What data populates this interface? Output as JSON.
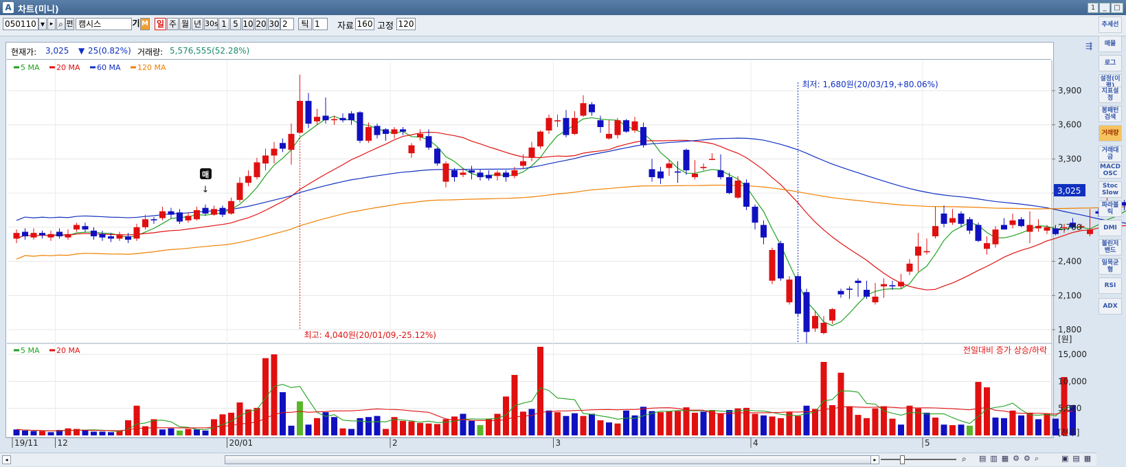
{
  "window": {
    "title": "차트(미니)",
    "logo_letter": "A",
    "buttons": [
      "1",
      "_",
      "□",
      "×"
    ]
  },
  "toolbar": {
    "code_value": "050110",
    "stock_name": "캠시스",
    "badge_gi": "기",
    "badge_m": "M",
    "periods": [
      "일",
      "주",
      "월",
      "년",
      "30s",
      "1",
      "5",
      "10",
      "20",
      "30"
    ],
    "period_input": "2",
    "tick_label": "틱",
    "tick_value": "1",
    "data_label": "자료",
    "data_value": "160",
    "fixed_label": "고정",
    "fixed_value": "120",
    "search_icon": "magnifier-icon",
    "pyeon_label": "편"
  },
  "infobar": {
    "price_label": "현재가:",
    "price_value": "3,025",
    "change_value": "25(0.82%)",
    "volume_label": "거래량:",
    "volume_value": "5,576,555(52.28%)"
  },
  "price_legend": [
    {
      "label": "5 MA",
      "color": "#1fa01f"
    },
    {
      "label": "20 MA",
      "color": "#e01010"
    },
    {
      "label": "60 MA",
      "color": "#1030c0"
    },
    {
      "label": "120 MA",
      "color": "#f08000"
    }
  ],
  "volume_legend": [
    {
      "label": "5 MA",
      "color": "#1fa01f"
    },
    {
      "label": "20 MA",
      "color": "#e01010"
    }
  ],
  "volume_note": "전일대비 증가 상승/하락",
  "annotations": {
    "high": "최고: 4,040원(20/01/09,-25.12%)",
    "low": "최저: 1,680원(20/03/19,+80.06%)",
    "buy_marker": "매"
  },
  "price_axis": {
    "ticks": [
      "3,900",
      "3,600",
      "3,300",
      "3,000",
      "2,700",
      "2,400",
      "2,100",
      "1,800"
    ],
    "unit": "[원]",
    "current": "3,025"
  },
  "volume_axis": {
    "ticks": [
      "15,000",
      "10,000",
      "5,000"
    ],
    "unit": "[천주]"
  },
  "date_axis": [
    "19/11",
    "12",
    "20/01",
    "2",
    "3",
    "4",
    "5"
  ],
  "right_tools": [
    "추세선",
    "매물",
    "로그",
    "설정(이평)",
    "지표설정",
    "봉패턴검색",
    "거래량",
    "거래대금",
    "MACD OSC",
    "Stoc Slow",
    "파라볼릭",
    "DMI",
    "볼린저밴드",
    "일목균형",
    "RSI",
    "ADX"
  ],
  "colors": {
    "up": "#e01010",
    "down": "#1010c0",
    "vol_up": "#e01010",
    "vol_down": "#1010c0",
    "vol_flat": "#5ab52a"
  },
  "chart_data": {
    "type": "candlestick",
    "price_range": [
      1680,
      4040
    ],
    "high_point": {
      "value": 4040,
      "date": "20/01/09"
    },
    "low_point": {
      "value": 1680,
      "date": "20/03/19"
    },
    "candles": [
      [
        2650,
        2600,
        2680,
        2560,
        1
      ],
      [
        2620,
        2660,
        2690,
        2590,
        0
      ],
      [
        2650,
        2610,
        2690,
        2590,
        1
      ],
      [
        2630,
        2650,
        2670,
        2600,
        0
      ],
      [
        2640,
        2610,
        2670,
        2580,
        1
      ],
      [
        2620,
        2660,
        2690,
        2600,
        0
      ],
      [
        2640,
        2610,
        2680,
        2590,
        1
      ],
      [
        2680,
        2720,
        2740,
        2660,
        1
      ],
      [
        2710,
        2680,
        2740,
        2660,
        0
      ],
      [
        2670,
        2620,
        2700,
        2590,
        0
      ],
      [
        2640,
        2610,
        2670,
        2580,
        0
      ],
      [
        2620,
        2600,
        2650,
        2570,
        0
      ],
      [
        2600,
        2630,
        2660,
        2580,
        1
      ],
      [
        2620,
        2590,
        2650,
        2560,
        0
      ],
      [
        2600,
        2700,
        2730,
        2580,
        1
      ],
      [
        2700,
        2770,
        2810,
        2680,
        1
      ],
      [
        2770,
        2760,
        2790,
        2730,
        0
      ],
      [
        2780,
        2840,
        2880,
        2760,
        1
      ],
      [
        2840,
        2810,
        2870,
        2780,
        0
      ],
      [
        2830,
        2750,
        2860,
        2730,
        0
      ],
      [
        2760,
        2800,
        2830,
        2740,
        1
      ],
      [
        2770,
        2850,
        2880,
        2760,
        1
      ],
      [
        2870,
        2820,
        2900,
        2800,
        0
      ],
      [
        2810,
        2860,
        2890,
        2800,
        1
      ],
      [
        2870,
        2810,
        2890,
        2790,
        0
      ],
      [
        2820,
        2930,
        2960,
        2810,
        1
      ],
      [
        2940,
        3090,
        3140,
        2920,
        1
      ],
      [
        3090,
        3150,
        3200,
        3060,
        1
      ],
      [
        3140,
        3270,
        3310,
        3120,
        1
      ],
      [
        3260,
        3330,
        3390,
        3200,
        1
      ],
      [
        3330,
        3390,
        3450,
        3260,
        1
      ],
      [
        3440,
        3390,
        3480,
        3360,
        0
      ],
      [
        3380,
        3520,
        3610,
        3250,
        1
      ],
      [
        3530,
        3810,
        4040,
        3520,
        1
      ],
      [
        3810,
        3610,
        3880,
        3570,
        0
      ],
      [
        3630,
        3670,
        3740,
        3600,
        1
      ],
      [
        3680,
        3640,
        3840,
        3610,
        0
      ],
      [
        3640,
        3650,
        3680,
        3600,
        1
      ],
      [
        3660,
        3640,
        3700,
        3620,
        0
      ],
      [
        3700,
        3640,
        3720,
        3600,
        0
      ],
      [
        3710,
        3460,
        3720,
        3440,
        0
      ],
      [
        3460,
        3580,
        3620,
        3440,
        1
      ],
      [
        3590,
        3510,
        3610,
        3480,
        0
      ],
      [
        3560,
        3520,
        3570,
        3460,
        0
      ],
      [
        3520,
        3560,
        3580,
        3480,
        1
      ],
      [
        3560,
        3540,
        3580,
        3510,
        0
      ],
      [
        3420,
        3350,
        3440,
        3310,
        1
      ],
      [
        3520,
        3490,
        3560,
        3460,
        1
      ],
      [
        3500,
        3400,
        3560,
        3380,
        0
      ],
      [
        3390,
        3260,
        3400,
        3240,
        0
      ],
      [
        3260,
        3100,
        3280,
        3050,
        1
      ],
      [
        3200,
        3140,
        3220,
        3100,
        0
      ],
      [
        3160,
        3180,
        3220,
        3140,
        1
      ],
      [
        3200,
        3180,
        3240,
        3120,
        0
      ],
      [
        3180,
        3140,
        3210,
        3110,
        0
      ],
      [
        3160,
        3130,
        3200,
        3110,
        0
      ],
      [
        3150,
        3180,
        3200,
        3110,
        1
      ],
      [
        3180,
        3140,
        3200,
        3100,
        0
      ],
      [
        3150,
        3200,
        3230,
        3130,
        1
      ],
      [
        3240,
        3280,
        3340,
        3210,
        1
      ],
      [
        3310,
        3400,
        3450,
        3280,
        1
      ],
      [
        3410,
        3540,
        3550,
        3390,
        1
      ],
      [
        3550,
        3660,
        3690,
        3520,
        1
      ],
      [
        3630,
        3640,
        3690,
        3580,
        1
      ],
      [
        3660,
        3510,
        3730,
        3490,
        0
      ],
      [
        3520,
        3660,
        3720,
        3510,
        1
      ],
      [
        3680,
        3790,
        3860,
        3670,
        1
      ],
      [
        3780,
        3710,
        3800,
        3680,
        0
      ],
      [
        3640,
        3580,
        3680,
        3530,
        0
      ],
      [
        3520,
        3480,
        3640,
        3470,
        1
      ],
      [
        3510,
        3640,
        3660,
        3480,
        1
      ],
      [
        3640,
        3540,
        3650,
        3530,
        0
      ],
      [
        3630,
        3550,
        3670,
        3530,
        1
      ],
      [
        3580,
        3420,
        3620,
        3400,
        0
      ],
      [
        3210,
        3140,
        3300,
        3100,
        0
      ],
      [
        3190,
        3130,
        3230,
        3080,
        0
      ],
      [
        3260,
        3220,
        3290,
        3150,
        1
      ],
      [
        3190,
        3180,
        3280,
        3090,
        0
      ],
      [
        3380,
        3200,
        3390,
        3160,
        0
      ],
      [
        3170,
        3140,
        3290,
        3120,
        1
      ],
      [
        3230,
        3220,
        3260,
        3200,
        1
      ],
      [
        3300,
        3300,
        3350,
        3290,
        1
      ],
      [
        3200,
        3140,
        3340,
        3120,
        0
      ],
      [
        3140,
        3000,
        3180,
        2990,
        0
      ],
      [
        3110,
        2960,
        3150,
        2950,
        1
      ],
      [
        3090,
        2880,
        3120,
        2850,
        0
      ],
      [
        2880,
        2740,
        2900,
        2680,
        0
      ],
      [
        2720,
        2610,
        2760,
        2550,
        0
      ],
      [
        2500,
        2230,
        2520,
        2200,
        1
      ],
      [
        2560,
        2250,
        2580,
        2230,
        0
      ],
      [
        2240,
        2040,
        2270,
        2020,
        1
      ],
      [
        2270,
        1940,
        2290,
        1910,
        0
      ],
      [
        2130,
        1780,
        2160,
        1680,
        0
      ],
      [
        1920,
        1810,
        1960,
        1780,
        1
      ],
      [
        1860,
        1770,
        1920,
        1760,
        1
      ],
      [
        1980,
        1880,
        1990,
        1850,
        1
      ],
      [
        2140,
        2110,
        2160,
        2080,
        0
      ],
      [
        2160,
        2150,
        2180,
        2070,
        0
      ],
      [
        2210,
        2230,
        2250,
        2090,
        0
      ],
      [
        2090,
        2150,
        2230,
        2070,
        0
      ],
      [
        2090,
        2040,
        2210,
        2020,
        1
      ],
      [
        2180,
        2200,
        2250,
        2080,
        1
      ],
      [
        2190,
        2180,
        2230,
        2150,
        0
      ],
      [
        2180,
        2220,
        2290,
        2160,
        1
      ],
      [
        2310,
        2380,
        2420,
        2280,
        1
      ],
      [
        2450,
        2530,
        2650,
        2310,
        1
      ],
      [
        2490,
        2480,
        2600,
        2460,
        1
      ],
      [
        2620,
        2710,
        2880,
        2600,
        1
      ],
      [
        2730,
        2820,
        2890,
        2700,
        0
      ],
      [
        2740,
        2780,
        2860,
        2720,
        1
      ],
      [
        2820,
        2730,
        2840,
        2700,
        0
      ],
      [
        2770,
        2670,
        2790,
        2640,
        0
      ],
      [
        2720,
        2580,
        2740,
        2570,
        0
      ],
      [
        2560,
        2510,
        2620,
        2460,
        1
      ],
      [
        2680,
        2550,
        2710,
        2520,
        1
      ],
      [
        2680,
        2720,
        2780,
        2680,
        0
      ],
      [
        2720,
        2760,
        2820,
        2690,
        1
      ],
      [
        2770,
        2710,
        2790,
        2700,
        0
      ],
      [
        2720,
        2660,
        2840,
        2560,
        1
      ],
      [
        2690,
        2710,
        2770,
        2660,
        1
      ],
      [
        2670,
        2700,
        2720,
        2640,
        1
      ],
      [
        2690,
        2640,
        2720,
        2630,
        0
      ],
      [
        2700,
        2700,
        2730,
        2650,
        1
      ],
      [
        2700,
        2740,
        2780,
        2690,
        0
      ],
      [
        2700,
        2710,
        2730,
        2680,
        1
      ],
      [
        2680,
        2640,
        2860,
        2620,
        1
      ],
      [
        2840,
        2820,
        2870,
        2790,
        0
      ],
      [
        2840,
        2920,
        2960,
        2820,
        1
      ],
      [
        2900,
        2880,
        2920,
        2860,
        0
      ],
      [
        2890,
        2920,
        2940,
        2850,
        0
      ],
      [
        2890,
        2850,
        2920,
        2810,
        1
      ],
      [
        2880,
        2850,
        2900,
        2810,
        0
      ],
      [
        2870,
        2820,
        2900,
        2800,
        1
      ],
      [
        2850,
        2800,
        2870,
        2790,
        0
      ],
      [
        2850,
        2850,
        2880,
        2780,
        1
      ],
      [
        2830,
        2850,
        2900,
        2820,
        0
      ],
      [
        2860,
        2880,
        2910,
        2850,
        0
      ],
      [
        2910,
        2900,
        2920,
        2870,
        0
      ],
      [
        2880,
        3040,
        3050,
        2860,
        1
      ],
      [
        2950,
        3030,
        3060,
        2940,
        0
      ]
    ],
    "volume_scale_max": 15000,
    "volumes": [
      [
        1100,
        0
      ],
      [
        900,
        0
      ],
      [
        800,
        0
      ],
      [
        800,
        1
      ],
      [
        600,
        0
      ],
      [
        1000,
        0
      ],
      [
        1300,
        1
      ],
      [
        1200,
        1
      ],
      [
        900,
        0
      ],
      [
        700,
        0
      ],
      [
        700,
        0
      ],
      [
        600,
        0
      ],
      [
        900,
        1
      ],
      [
        2800,
        1
      ],
      [
        5500,
        1
      ],
      [
        1700,
        1
      ],
      [
        3000,
        1
      ],
      [
        1100,
        0
      ],
      [
        1300,
        0
      ],
      [
        900,
        2
      ],
      [
        1200,
        1
      ],
      [
        1100,
        0
      ],
      [
        900,
        0
      ],
      [
        3000,
        1
      ],
      [
        3900,
        1
      ],
      [
        4200,
        1
      ],
      [
        6100,
        1
      ],
      [
        4800,
        1
      ],
      [
        5100,
        1
      ],
      [
        14300,
        1
      ],
      [
        15000,
        1
      ],
      [
        8000,
        0
      ],
      [
        1800,
        0
      ],
      [
        6300,
        2
      ],
      [
        2000,
        0
      ],
      [
        3200,
        1
      ],
      [
        4300,
        0
      ],
      [
        3400,
        0
      ],
      [
        1300,
        1
      ],
      [
        1200,
        0
      ],
      [
        3200,
        0
      ],
      [
        3400,
        0
      ],
      [
        3600,
        0
      ],
      [
        1200,
        1
      ],
      [
        3400,
        1
      ],
      [
        2700,
        1
      ],
      [
        2600,
        1
      ],
      [
        2300,
        1
      ],
      [
        2200,
        1
      ],
      [
        2100,
        1
      ],
      [
        3000,
        1
      ],
      [
        3500,
        1
      ],
      [
        4000,
        0
      ],
      [
        2700,
        0
      ],
      [
        1900,
        2
      ],
      [
        3100,
        1
      ],
      [
        4000,
        1
      ],
      [
        7200,
        1
      ],
      [
        11200,
        1
      ],
      [
        4400,
        1
      ],
      [
        4900,
        0
      ],
      [
        16400,
        1
      ],
      [
        4600,
        0
      ],
      [
        4300,
        1
      ],
      [
        3600,
        0
      ],
      [
        4100,
        0
      ],
      [
        3600,
        1
      ],
      [
        4000,
        0
      ],
      [
        2800,
        1
      ],
      [
        2400,
        0
      ],
      [
        2200,
        1
      ],
      [
        4600,
        0
      ],
      [
        3700,
        0
      ],
      [
        5300,
        0
      ],
      [
        4500,
        0
      ],
      [
        4300,
        1
      ],
      [
        4500,
        1
      ],
      [
        4500,
        1
      ],
      [
        5200,
        1
      ],
      [
        4200,
        1
      ],
      [
        4400,
        0
      ],
      [
        4700,
        1
      ],
      [
        4000,
        1
      ],
      [
        4700,
        0
      ],
      [
        5000,
        1
      ],
      [
        5100,
        1
      ],
      [
        4000,
        1
      ],
      [
        3700,
        0
      ],
      [
        3500,
        1
      ],
      [
        3200,
        1
      ],
      [
        4300,
        1
      ],
      [
        3600,
        1
      ],
      [
        5500,
        0
      ],
      [
        4900,
        1
      ],
      [
        13600,
        1
      ],
      [
        5600,
        1
      ],
      [
        11600,
        1
      ],
      [
        5400,
        1
      ],
      [
        3800,
        1
      ],
      [
        3200,
        1
      ],
      [
        5000,
        1
      ],
      [
        5400,
        1
      ],
      [
        3100,
        1
      ],
      [
        2000,
        0
      ],
      [
        5500,
        1
      ],
      [
        5000,
        1
      ],
      [
        4200,
        0
      ],
      [
        3300,
        1
      ],
      [
        2000,
        0
      ],
      [
        1900,
        1
      ],
      [
        2000,
        0
      ],
      [
        1800,
        2
      ],
      [
        9900,
        1
      ],
      [
        8900,
        1
      ],
      [
        3300,
        0
      ],
      [
        3200,
        0
      ],
      [
        4600,
        1
      ],
      [
        3700,
        0
      ],
      [
        4200,
        1
      ],
      [
        3000,
        0
      ],
      [
        4000,
        1
      ],
      [
        3100,
        0
      ],
      [
        10800,
        1
      ],
      [
        5600,
        0
      ]
    ]
  }
}
